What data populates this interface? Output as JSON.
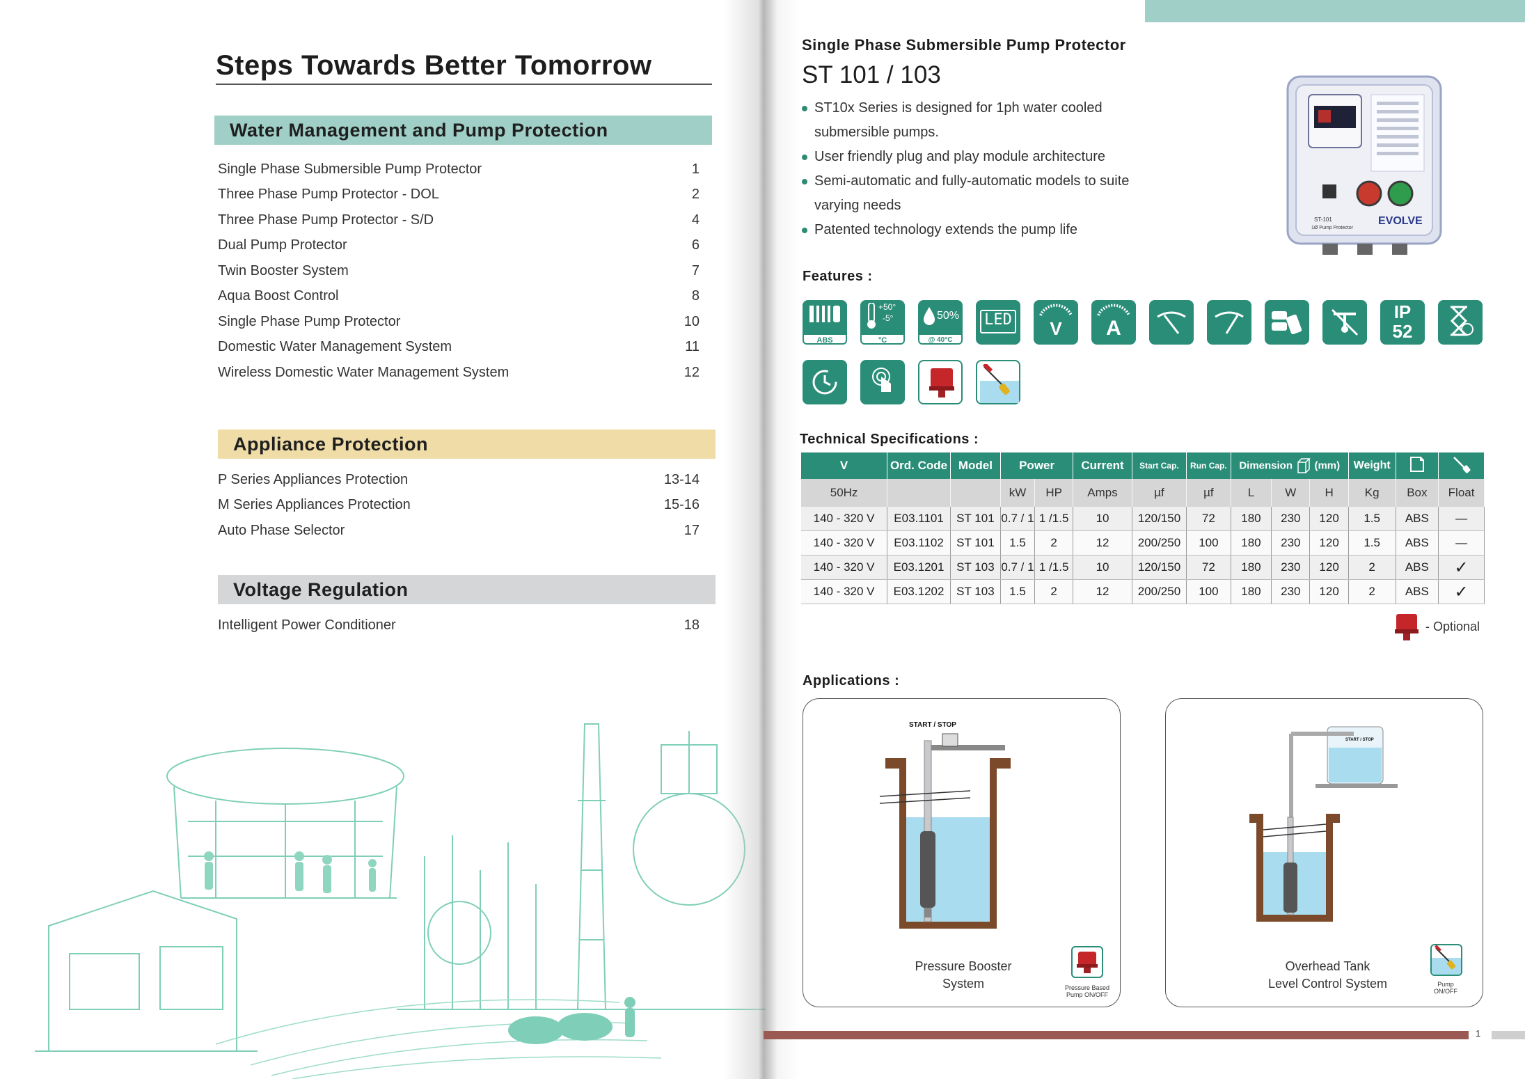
{
  "left": {
    "title": "Steps Towards Better Tomorrow",
    "sections": [
      {
        "heading": "Water Management and Pump Protection",
        "color": "#9fcfc6",
        "items": [
          {
            "label": "Single Phase Submersible Pump Protector",
            "page": "1"
          },
          {
            "label": "Three Phase Pump Protector - DOL",
            "page": "2"
          },
          {
            "label": "Three Phase Pump Protector - S/D",
            "page": "4"
          },
          {
            "label": "Dual Pump Protector",
            "page": "6"
          },
          {
            "label": "Twin Booster System",
            "page": "7"
          },
          {
            "label": "Aqua Boost Control",
            "page": "8"
          },
          {
            "label": "Single Phase Pump Protector",
            "page": "10"
          },
          {
            "label": "Domestic Water Management System",
            "page": "11"
          },
          {
            "label": "Wireless  Domestic Water Management System",
            "page": "12"
          }
        ]
      },
      {
        "heading": "Appliance Protection",
        "color": "#efdca6",
        "items": [
          {
            "label": "P  Series Appliances Protection",
            "page": "13-14"
          },
          {
            "label": "M Series Appliances Protection",
            "page": "15-16"
          },
          {
            "label": "Auto Phase Selector",
            "page": "17"
          }
        ]
      },
      {
        "heading": "Voltage Regulation",
        "color": "#d5d6d8",
        "items": [
          {
            "label": "Intelligent Power Conditioner",
            "page": "18"
          }
        ]
      }
    ]
  },
  "right": {
    "subtitle": "Single Phase Submersible Pump Protector",
    "title": "ST 101 / 103",
    "bullets": [
      "ST10x Series is designed  for 1ph water cooled submersible pumps.",
      "User friendly plug and play module architecture",
      "Semi-automatic and fully-automatic models to suite varying needs",
      "Patented technology extends the pump life"
    ],
    "product_panel": {
      "model": "ST-101",
      "caption": "1Ø Pump Protector",
      "brand": "EVOLVE"
    },
    "features_label": "Features :",
    "features": {
      "abs": "ABS",
      "temp_high": "+50°",
      "temp_low": "-5°",
      "temp_unit": "°C",
      "humidity": "50%",
      "humidity_cap": "@ 40°C",
      "led": "LED",
      "volt": "V",
      "amp": "A",
      "ip_top": "IP",
      "ip_num": "52"
    },
    "tech_label": "Technical Specifications :",
    "table": {
      "headers": [
        "V",
        "Ord. Code",
        "Model",
        "Power",
        "Current",
        "Start Cap.",
        "Run Cap.",
        "Dimension",
        "(mm)",
        "Weight"
      ],
      "units": [
        "50Hz",
        "",
        "",
        "kW",
        "HP",
        "Amps",
        "µf",
        "µf",
        "L",
        "W",
        "H",
        "Kg",
        "Box",
        "Float"
      ],
      "rows": [
        [
          "140 - 320 V",
          "E03.1101",
          "ST 101",
          "0.7 / 1",
          "1 /1.5",
          "10",
          "120/150",
          "72",
          "180",
          "230",
          "120",
          "1.5",
          "ABS",
          "—"
        ],
        [
          "140 - 320 V",
          "E03.1102",
          "ST 101",
          "1.5",
          "2",
          "12",
          "200/250",
          "100",
          "180",
          "230",
          "120",
          "1.5",
          "ABS",
          "—"
        ],
        [
          "140 - 320 V",
          "E03.1201",
          "ST 103",
          "0.7 / 1",
          "1 /1.5",
          "10",
          "120/150",
          "72",
          "180",
          "230",
          "120",
          "2",
          "ABS",
          "✓"
        ],
        [
          "140 - 320 V",
          "E03.1202",
          "ST 103",
          "1.5",
          "2",
          "12",
          "200/250",
          "100",
          "180",
          "230",
          "120",
          "2",
          "ABS",
          "✓"
        ]
      ]
    },
    "optional_label": "- Optional",
    "applications_label": "Applications :",
    "applications": [
      {
        "caption_line1": "Pressure Booster",
        "caption_line2": "System",
        "diagram_text": "START / STOP",
        "icon_caption_1": "Pressure Based",
        "icon_caption_2": "Pump ON/OFF"
      },
      {
        "caption_line1": "Overhead Tank",
        "caption_line2": "Level Control  System",
        "diagram_text": "START / STOP",
        "icon_caption_1": "Pump",
        "icon_caption_2": "ON/OFF"
      }
    ],
    "page_number": "1"
  },
  "colors": {
    "teal": "#2a8d78",
    "mint": "#9fcfc6",
    "sand": "#efdca6",
    "grey": "#d5d6d8",
    "brick": "#9a5a53",
    "water": "#a9dcef",
    "earth": "#7b4a2b"
  }
}
